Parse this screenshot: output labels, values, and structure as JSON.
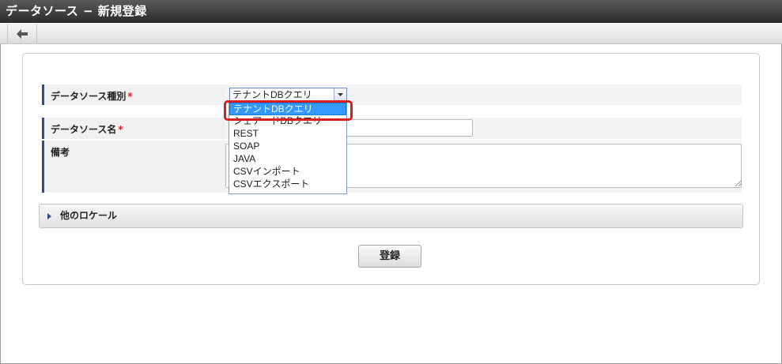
{
  "window": {
    "title": "データソース − 新規登録"
  },
  "toolbar": {
    "back_icon": "arrow-left-icon"
  },
  "form": {
    "fields": {
      "type": {
        "label": "データソース種別",
        "required_mark": "*",
        "selected_value": "テナントDBクエリ"
      },
      "name": {
        "label": "データソース名",
        "required_mark": "*",
        "value": ""
      },
      "note": {
        "label": "備考",
        "value": ""
      }
    },
    "dropdown_options": [
      "テナントDBクエリ",
      "シェアードDBクエリ",
      "REST",
      "SOAP",
      "JAVA",
      "CSVインポート",
      "CSVエクスポート"
    ],
    "other_locale_label": "他のロケール",
    "submit_label": "登録"
  },
  "colors": {
    "accent_border": "#2f4c8c",
    "required": "#d21f1f",
    "dropdown_selected": "#3399ff",
    "callout_highlight": "#d81e1e"
  }
}
